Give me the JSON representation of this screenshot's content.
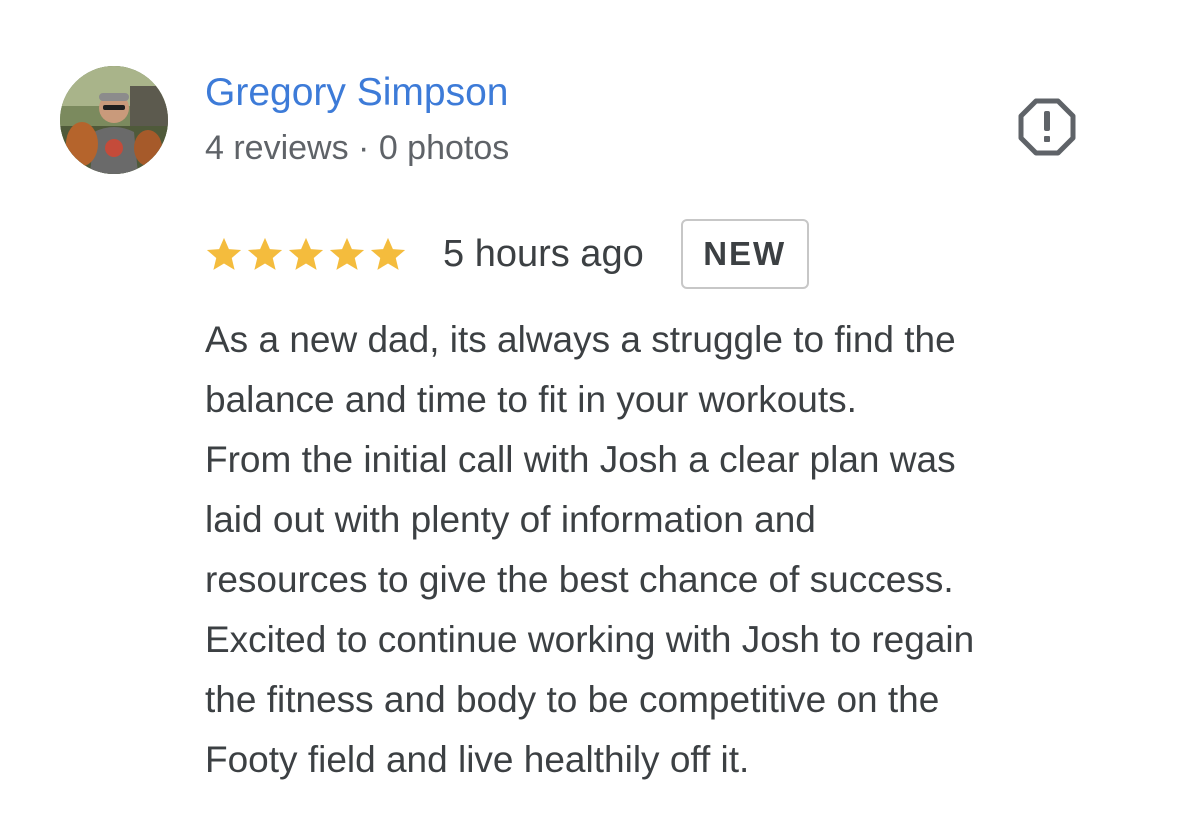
{
  "reviewer": {
    "name": "Gregory Simpson",
    "meta": "4 reviews · 0 photos",
    "avatar_icon": "profile-photo"
  },
  "report": {
    "icon": "report-octagon-icon"
  },
  "review": {
    "rating": 5,
    "rating_max": 5,
    "star_color": "#f4bc3d",
    "time_ago": "5 hours ago",
    "badge": "NEW",
    "lines": [
      "As a new dad, its always a struggle to find the",
      "balance and time to fit in your workouts.",
      "From the initial call with Josh a clear plan was",
      "laid out with plenty of information and",
      "resources to give the best chance of success.",
      "Excited to continue working with Josh to regain",
      "the fitness and body to be competitive on the",
      "Footy field and live healthily off it."
    ]
  },
  "colors": {
    "name_link": "#3d7bd8",
    "text": "#3c4043",
    "meta": "#5f6368"
  }
}
